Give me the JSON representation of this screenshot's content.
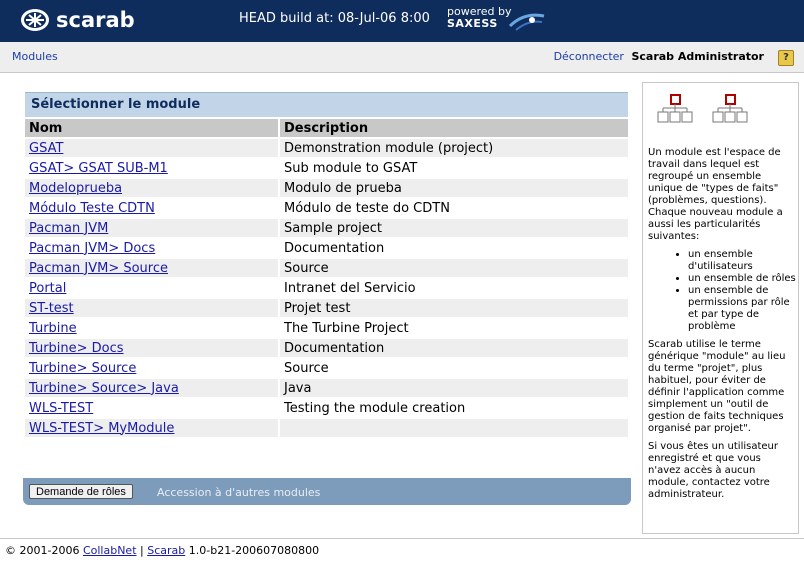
{
  "header": {
    "app_name": "scarab",
    "build_text": "HEAD build at: 08-Jul-06 8:00",
    "powered_by": "powered by",
    "powered_company": "SAXESS"
  },
  "nav": {
    "modules_link": "Modules",
    "logout_link": "Déconnecter",
    "user_name": "Scarab Administrator",
    "help_label": "?"
  },
  "panel": {
    "title": "Sélectionner le module",
    "columns": [
      "Nom",
      "Description"
    ],
    "rows": [
      {
        "name": "GSAT",
        "description": "Demonstration module (project)"
      },
      {
        "name": "GSAT> GSAT SUB-M1",
        "description": "Sub module to GSAT"
      },
      {
        "name": "Modeloprueba",
        "description": "Modulo de prueba"
      },
      {
        "name": "Módulo Teste CDTN",
        "description": "Módulo de teste do CDTN"
      },
      {
        "name": "Pacman JVM",
        "description": "Sample project"
      },
      {
        "name": "Pacman JVM> Docs",
        "description": "Documentation"
      },
      {
        "name": "Pacman JVM> Source",
        "description": "Source"
      },
      {
        "name": "Portal",
        "description": "Intranet del Servicio"
      },
      {
        "name": "ST-test",
        "description": "Projet test"
      },
      {
        "name": "Turbine",
        "description": "The Turbine Project"
      },
      {
        "name": "Turbine> Docs",
        "description": "Documentation"
      },
      {
        "name": "Turbine> Source",
        "description": "Source"
      },
      {
        "name": "Turbine> Source> Java",
        "description": "Java"
      },
      {
        "name": "WLS-TEST",
        "description": "Testing the module creation"
      },
      {
        "name": "WLS-TEST> MyModule",
        "description": ""
      }
    ],
    "request_roles_button": "Demande de rôles",
    "access_text": "Accession à d'autres modules"
  },
  "side": {
    "p1": "Un module est l'espace de travail dans lequel est regroupé un ensemble unique de \"types de faits\" (problèmes, questions). Chaque nouveau module a aussi les particularités suivantes:",
    "bullets": [
      "un ensemble d'utilisateurs",
      "un ensemble de rôles",
      "un ensemble de permissions par rôle et par type de problème"
    ],
    "p2": "Scarab utilise le terme générique \"module\" au lieu du terme \"projet\", plus habituel, pour éviter de définir l'application comme simplement un \"outil de gestion de faits techniques organisé par projet\".",
    "p3": "Si vous êtes un utilisateur enregistré et que vous n'avez accès à aucun module, contactez votre administrateur."
  },
  "footer": {
    "copyright": "© 2001-2006 ",
    "collabnet": "CollabNet",
    "sep": " | ",
    "scarab": "Scarab",
    "version": " 1.0-b21-200607080800"
  },
  "colors": {
    "header_bg": "#0f2d5c",
    "panel_title_bg": "#c2d5e8",
    "action_bar_bg": "#7d9cbc",
    "link": "#1a1aa8"
  }
}
